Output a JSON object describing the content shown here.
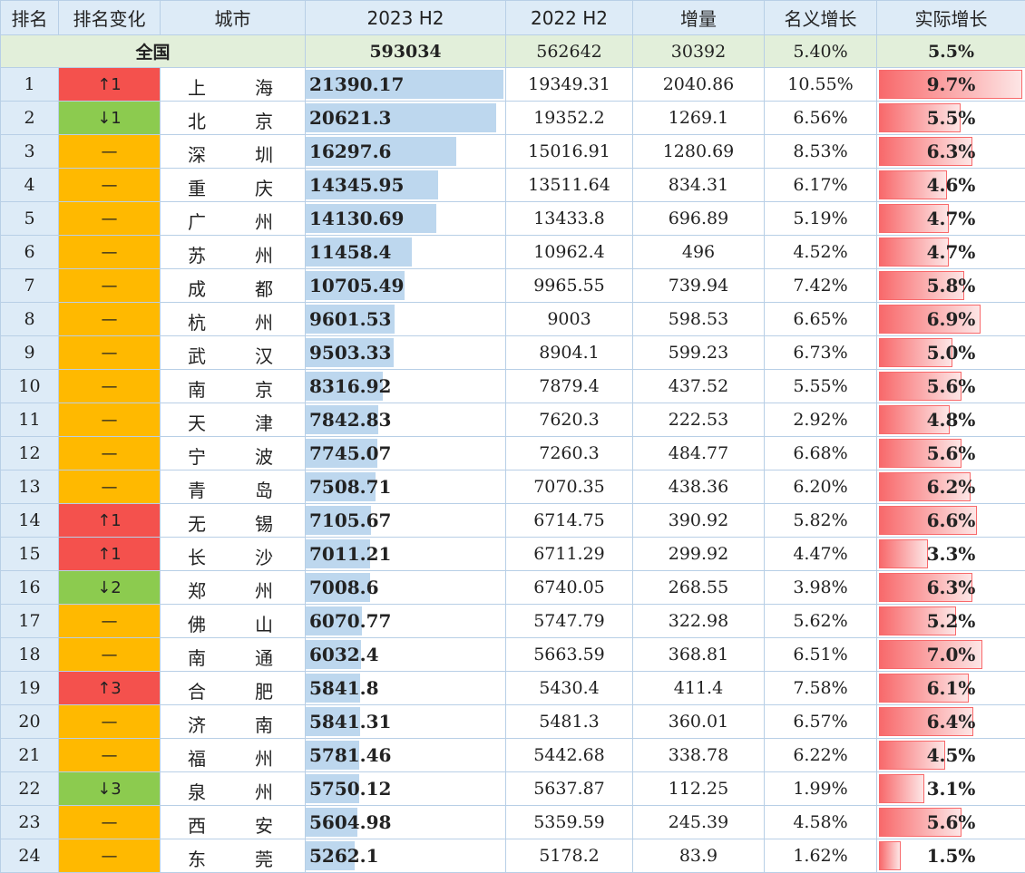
{
  "headers": {
    "rank": "排名",
    "change": "排名变化",
    "city": "城市",
    "h2_2023": "2023 H2",
    "h2_2022": "2022 H2",
    "increase": "增量",
    "nominal": "名义增长",
    "real": "实际增长"
  },
  "national": {
    "label": "全国",
    "h2_2023": "593034",
    "h2_2022": "562642",
    "increase": "30392",
    "nominal": "5.40%",
    "real": "5.5%"
  },
  "rows": [
    {
      "rank": "1",
      "change": "↑1",
      "dir": "up",
      "c1": "上",
      "c2": "海",
      "v2023": "21390.17",
      "v2022": "19349.31",
      "inc": "2040.86",
      "nom": "10.55%",
      "real": "9.7%",
      "realNum": 9.7
    },
    {
      "rank": "2",
      "change": "↓1",
      "dir": "down",
      "c1": "北",
      "c2": "京",
      "v2023": "20621.3",
      "v2022": "19352.2",
      "inc": "1269.1",
      "nom": "6.56%",
      "real": "5.5%",
      "realNum": 5.5
    },
    {
      "rank": "3",
      "change": "—",
      "dir": "same",
      "c1": "深",
      "c2": "圳",
      "v2023": "16297.6",
      "v2022": "15016.91",
      "inc": "1280.69",
      "nom": "8.53%",
      "real": "6.3%",
      "realNum": 6.3
    },
    {
      "rank": "4",
      "change": "—",
      "dir": "same",
      "c1": "重",
      "c2": "庆",
      "v2023": "14345.95",
      "v2022": "13511.64",
      "inc": "834.31",
      "nom": "6.17%",
      "real": "4.6%",
      "realNum": 4.6
    },
    {
      "rank": "5",
      "change": "—",
      "dir": "same",
      "c1": "广",
      "c2": "州",
      "v2023": "14130.69",
      "v2022": "13433.8",
      "inc": "696.89",
      "nom": "5.19%",
      "real": "4.7%",
      "realNum": 4.7
    },
    {
      "rank": "6",
      "change": "—",
      "dir": "same",
      "c1": "苏",
      "c2": "州",
      "v2023": "11458.4",
      "v2022": "10962.4",
      "inc": "496",
      "nom": "4.52%",
      "real": "4.7%",
      "realNum": 4.7
    },
    {
      "rank": "7",
      "change": "—",
      "dir": "same",
      "c1": "成",
      "c2": "都",
      "v2023": "10705.49",
      "v2022": "9965.55",
      "inc": "739.94",
      "nom": "7.42%",
      "real": "5.8%",
      "realNum": 5.8
    },
    {
      "rank": "8",
      "change": "—",
      "dir": "same",
      "c1": "杭",
      "c2": "州",
      "v2023": "9601.53",
      "v2022": "9003",
      "inc": "598.53",
      "nom": "6.65%",
      "real": "6.9%",
      "realNum": 6.9
    },
    {
      "rank": "9",
      "change": "—",
      "dir": "same",
      "c1": "武",
      "c2": "汉",
      "v2023": "9503.33",
      "v2022": "8904.1",
      "inc": "599.23",
      "nom": "6.73%",
      "real": "5.0%",
      "realNum": 5.0
    },
    {
      "rank": "10",
      "change": "—",
      "dir": "same",
      "c1": "南",
      "c2": "京",
      "v2023": "8316.92",
      "v2022": "7879.4",
      "inc": "437.52",
      "nom": "5.55%",
      "real": "5.6%",
      "realNum": 5.6
    },
    {
      "rank": "11",
      "change": "—",
      "dir": "same",
      "c1": "天",
      "c2": "津",
      "v2023": "7842.83",
      "v2022": "7620.3",
      "inc": "222.53",
      "nom": "2.92%",
      "real": "4.8%",
      "realNum": 4.8
    },
    {
      "rank": "12",
      "change": "—",
      "dir": "same",
      "c1": "宁",
      "c2": "波",
      "v2023": "7745.07",
      "v2022": "7260.3",
      "inc": "484.77",
      "nom": "6.68%",
      "real": "5.6%",
      "realNum": 5.6
    },
    {
      "rank": "13",
      "change": "—",
      "dir": "same",
      "c1": "青",
      "c2": "岛",
      "v2023": "7508.71",
      "v2022": "7070.35",
      "inc": "438.36",
      "nom": "6.20%",
      "real": "6.2%",
      "realNum": 6.2
    },
    {
      "rank": "14",
      "change": "↑1",
      "dir": "up",
      "c1": "无",
      "c2": "锡",
      "v2023": "7105.67",
      "v2022": "6714.75",
      "inc": "390.92",
      "nom": "5.82%",
      "real": "6.6%",
      "realNum": 6.6
    },
    {
      "rank": "15",
      "change": "↑1",
      "dir": "up",
      "c1": "长",
      "c2": "沙",
      "v2023": "7011.21",
      "v2022": "6711.29",
      "inc": "299.92",
      "nom": "4.47%",
      "real": "3.3%",
      "realNum": 3.3
    },
    {
      "rank": "16",
      "change": "↓2",
      "dir": "down",
      "c1": "郑",
      "c2": "州",
      "v2023": "7008.6",
      "v2022": "6740.05",
      "inc": "268.55",
      "nom": "3.98%",
      "real": "6.3%",
      "realNum": 6.3
    },
    {
      "rank": "17",
      "change": "—",
      "dir": "same",
      "c1": "佛",
      "c2": "山",
      "v2023": "6070.77",
      "v2022": "5747.79",
      "inc": "322.98",
      "nom": "5.62%",
      "real": "5.2%",
      "realNum": 5.2
    },
    {
      "rank": "18",
      "change": "—",
      "dir": "same",
      "c1": "南",
      "c2": "通",
      "v2023": "6032.4",
      "v2022": "5663.59",
      "inc": "368.81",
      "nom": "6.51%",
      "real": "7.0%",
      "realNum": 7.0
    },
    {
      "rank": "19",
      "change": "↑3",
      "dir": "up",
      "c1": "合",
      "c2": "肥",
      "v2023": "5841.8",
      "v2022": "5430.4",
      "inc": "411.4",
      "nom": "7.58%",
      "real": "6.1%",
      "realNum": 6.1
    },
    {
      "rank": "20",
      "change": "—",
      "dir": "same",
      "c1": "济",
      "c2": "南",
      "v2023": "5841.31",
      "v2022": "5481.3",
      "inc": "360.01",
      "nom": "6.57%",
      "real": "6.4%",
      "realNum": 6.4
    },
    {
      "rank": "21",
      "change": "—",
      "dir": "same",
      "c1": "福",
      "c2": "州",
      "v2023": "5781.46",
      "v2022": "5442.68",
      "inc": "338.78",
      "nom": "6.22%",
      "real": "4.5%",
      "realNum": 4.5
    },
    {
      "rank": "22",
      "change": "↓3",
      "dir": "down",
      "c1": "泉",
      "c2": "州",
      "v2023": "5750.12",
      "v2022": "5637.87",
      "inc": "112.25",
      "nom": "1.99%",
      "real": "3.1%",
      "realNum": 3.1
    },
    {
      "rank": "23",
      "change": "—",
      "dir": "same",
      "c1": "西",
      "c2": "安",
      "v2023": "5604.98",
      "v2022": "5359.59",
      "inc": "245.39",
      "nom": "4.58%",
      "real": "5.6%",
      "realNum": 5.6
    },
    {
      "rank": "24",
      "change": "—",
      "dir": "same",
      "c1": "东",
      "c2": "莞",
      "v2023": "5262.1",
      "v2022": "5178.2",
      "inc": "83.9",
      "nom": "1.62%",
      "real": "1.5%",
      "realNum": 1.5
    }
  ]
}
